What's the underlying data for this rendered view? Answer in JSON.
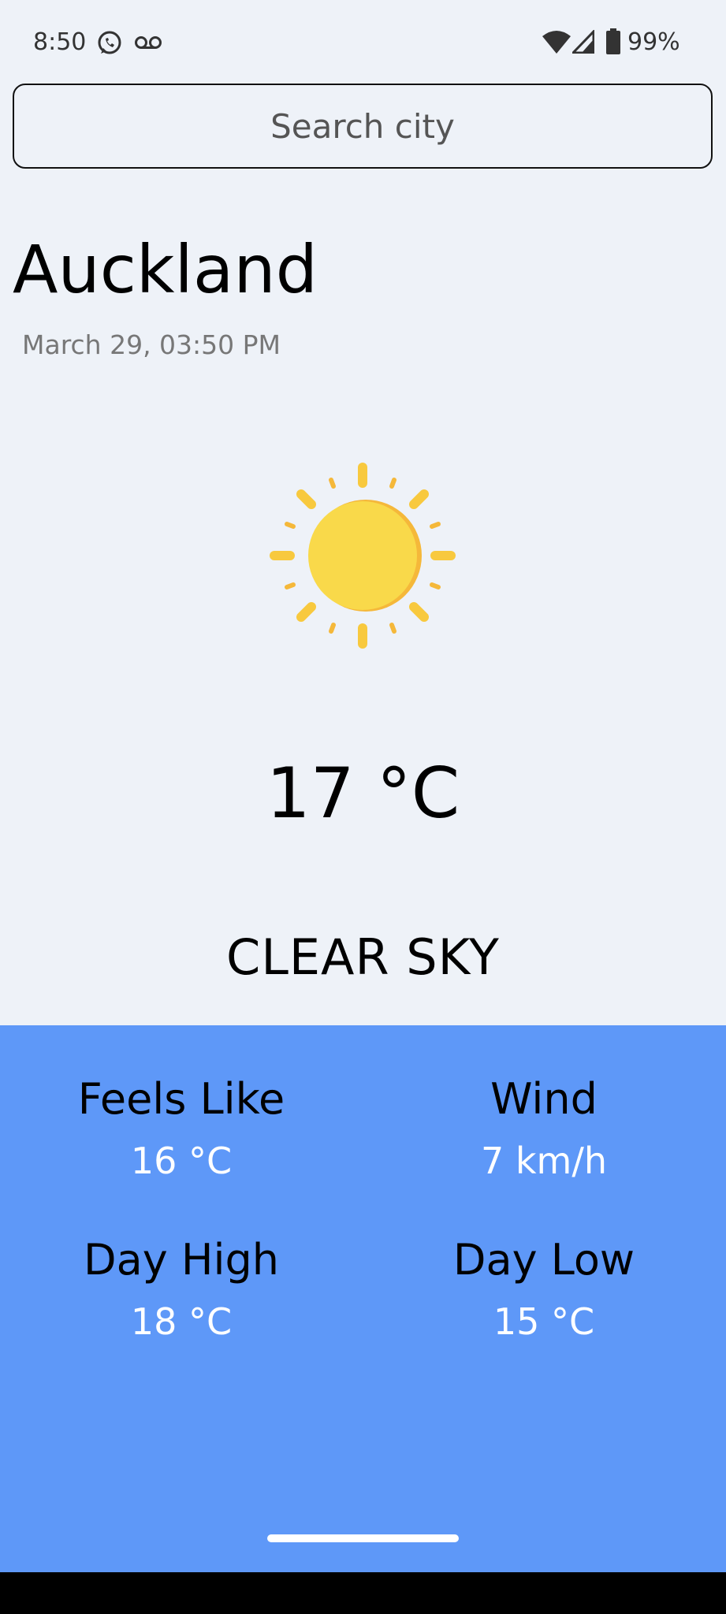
{
  "status_bar": {
    "time": "8:50",
    "battery_percent": "99%",
    "icons": [
      "whatsapp-icon",
      "voicemail-icon",
      "wifi-icon",
      "cell-signal-icon",
      "battery-icon"
    ]
  },
  "search": {
    "placeholder": "Search city",
    "value": ""
  },
  "location": {
    "city": "Auckland",
    "datetime": "March 29, 03:50 PM"
  },
  "weather": {
    "icon": "sun-icon",
    "temperature": "17 °C",
    "condition": "CLEAR SKY"
  },
  "details": {
    "feels_like": {
      "label": "Feels Like",
      "value": "16 °C"
    },
    "wind": {
      "label": "Wind",
      "value": "7 km/h"
    },
    "day_high": {
      "label": "Day High",
      "value": "18 °C"
    },
    "day_low": {
      "label": "Day Low",
      "value": "15 °C"
    }
  },
  "colors": {
    "background": "#eef2f8",
    "details_panel": "#5e98f8",
    "sun_core": "#f9d94a",
    "sun_rays": "#f5b83a"
  }
}
